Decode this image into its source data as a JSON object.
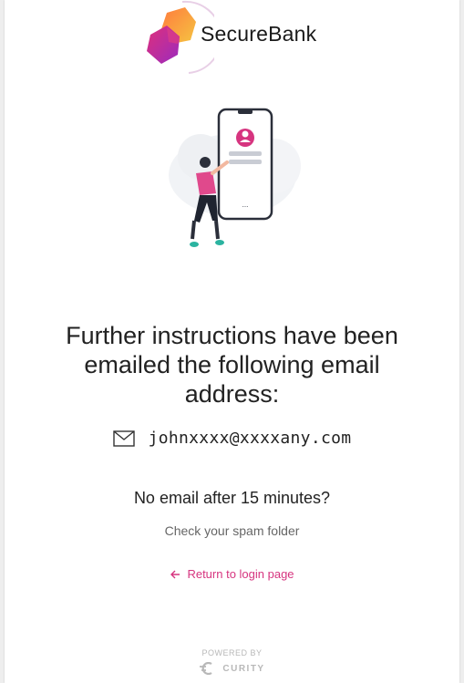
{
  "brand": {
    "name": "SecureBank",
    "colors": {
      "accent": "#d6347f",
      "logo_pink": "#c2298a",
      "logo_orange": "#f5a23a"
    }
  },
  "main": {
    "heading": "Further instructions have been emailed the following email address:",
    "email": "johnxxxx@xxxxany.com",
    "no_email": "No email after 15 minutes?",
    "spam_hint": "Check your spam folder",
    "return_link": "Return to login page"
  },
  "footer": {
    "powered_by": "POWERED BY",
    "vendor": "CURITY"
  },
  "icons": [
    "securebank-logo-icon",
    "phone-illustration",
    "mail-icon",
    "arrow-left-icon",
    "curity-logo-icon"
  ]
}
